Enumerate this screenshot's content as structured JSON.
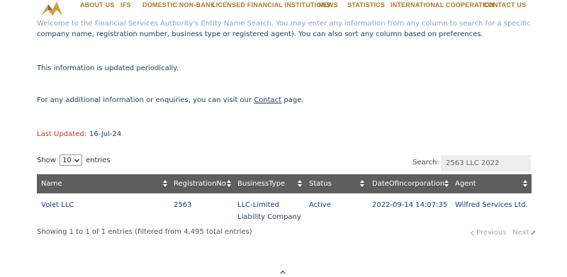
{
  "nav": {
    "items": [
      {
        "label": "ABOUT US"
      },
      {
        "label": "IFS"
      },
      {
        "label": "DOMESTIC NON-BANK"
      },
      {
        "label": "LICENSED FINANCIAL INSTITUTIONS"
      },
      {
        "label": "NEWS"
      },
      {
        "label": "STATISTICS"
      },
      {
        "label": "INTERNATIONAL COOPERATION"
      },
      {
        "label": "CONTACT US"
      }
    ]
  },
  "intro": {
    "line1": "Welcome to the Financial Services Authority's Entity Name Search. You may enter any information from any column to search for a specific entity (i.e.",
    "line2": "company name, registration number, business type or registered agent). You can also sort any column based on preferences.",
    "updated_msg": "This information is updated periodically.",
    "contact_prefix": "For any additional information or enquiries, you can visit our ",
    "contact_link": "Contact",
    "contact_suffix": " page."
  },
  "last_updated": {
    "label": "Last Updated:",
    "value": "16-Jul-24"
  },
  "controls": {
    "show_label": "Show",
    "page_size": "10",
    "entries_label": "entries",
    "search_label": "Search:",
    "search_value": "2563 LLC 2022"
  },
  "table": {
    "columns": [
      "Name",
      "RegistrationNo",
      "BusinessType",
      "Status",
      "DateOfIncorporation",
      "Agent"
    ],
    "rows": [
      {
        "name": "Volet LLC",
        "registration_no": "2563",
        "business_type_line1": "LLC-Limited",
        "business_type_line2": "Liability Company",
        "status": "Active",
        "date_of_incorporation": "2022-09-14 14:07:35",
        "agent": "Wilfred Services Ltd."
      }
    ]
  },
  "footer": {
    "info": "Showing 1 to 1 of 1 entries (filtered from 4,495 total entries)",
    "previous": "Previous",
    "next": "Next"
  },
  "colors": {
    "nav_text": "#a9782d",
    "body_text": "#1f3a5f",
    "last_updated_label": "#c0392b",
    "table_header_bg": "#5e5e5e"
  },
  "icons": [
    "logo-icon",
    "sort-icon",
    "chevron-down-icon",
    "chevron-left-icon",
    "chevron-up-icon"
  ]
}
